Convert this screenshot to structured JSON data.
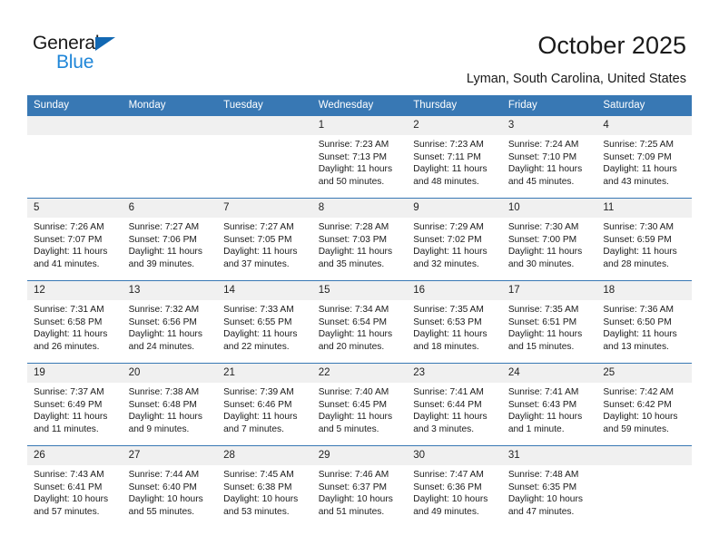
{
  "brand": {
    "name_dark": "General",
    "name_light": "Blue",
    "triangle_color": "#1268b3",
    "light_color": "#1f86d8"
  },
  "header": {
    "title": "October 2025",
    "location": "Lyman, South Carolina, United States"
  },
  "theme": {
    "header_blue": "#3878b4",
    "daynum_gray": "#f0f0f0",
    "text": "#1a1a1a"
  },
  "weekdays": [
    "Sunday",
    "Monday",
    "Tuesday",
    "Wednesday",
    "Thursday",
    "Friday",
    "Saturday"
  ],
  "weeks": [
    [
      {
        "day": "",
        "info": ""
      },
      {
        "day": "",
        "info": ""
      },
      {
        "day": "",
        "info": ""
      },
      {
        "day": "1",
        "info": "Sunrise: 7:23 AM\nSunset: 7:13 PM\nDaylight: 11 hours\nand 50 minutes."
      },
      {
        "day": "2",
        "info": "Sunrise: 7:23 AM\nSunset: 7:11 PM\nDaylight: 11 hours\nand 48 minutes."
      },
      {
        "day": "3",
        "info": "Sunrise: 7:24 AM\nSunset: 7:10 PM\nDaylight: 11 hours\nand 45 minutes."
      },
      {
        "day": "4",
        "info": "Sunrise: 7:25 AM\nSunset: 7:09 PM\nDaylight: 11 hours\nand 43 minutes."
      }
    ],
    [
      {
        "day": "5",
        "info": "Sunrise: 7:26 AM\nSunset: 7:07 PM\nDaylight: 11 hours\nand 41 minutes."
      },
      {
        "day": "6",
        "info": "Sunrise: 7:27 AM\nSunset: 7:06 PM\nDaylight: 11 hours\nand 39 minutes."
      },
      {
        "day": "7",
        "info": "Sunrise: 7:27 AM\nSunset: 7:05 PM\nDaylight: 11 hours\nand 37 minutes."
      },
      {
        "day": "8",
        "info": "Sunrise: 7:28 AM\nSunset: 7:03 PM\nDaylight: 11 hours\nand 35 minutes."
      },
      {
        "day": "9",
        "info": "Sunrise: 7:29 AM\nSunset: 7:02 PM\nDaylight: 11 hours\nand 32 minutes."
      },
      {
        "day": "10",
        "info": "Sunrise: 7:30 AM\nSunset: 7:00 PM\nDaylight: 11 hours\nand 30 minutes."
      },
      {
        "day": "11",
        "info": "Sunrise: 7:30 AM\nSunset: 6:59 PM\nDaylight: 11 hours\nand 28 minutes."
      }
    ],
    [
      {
        "day": "12",
        "info": "Sunrise: 7:31 AM\nSunset: 6:58 PM\nDaylight: 11 hours\nand 26 minutes."
      },
      {
        "day": "13",
        "info": "Sunrise: 7:32 AM\nSunset: 6:56 PM\nDaylight: 11 hours\nand 24 minutes."
      },
      {
        "day": "14",
        "info": "Sunrise: 7:33 AM\nSunset: 6:55 PM\nDaylight: 11 hours\nand 22 minutes."
      },
      {
        "day": "15",
        "info": "Sunrise: 7:34 AM\nSunset: 6:54 PM\nDaylight: 11 hours\nand 20 minutes."
      },
      {
        "day": "16",
        "info": "Sunrise: 7:35 AM\nSunset: 6:53 PM\nDaylight: 11 hours\nand 18 minutes."
      },
      {
        "day": "17",
        "info": "Sunrise: 7:35 AM\nSunset: 6:51 PM\nDaylight: 11 hours\nand 15 minutes."
      },
      {
        "day": "18",
        "info": "Sunrise: 7:36 AM\nSunset: 6:50 PM\nDaylight: 11 hours\nand 13 minutes."
      }
    ],
    [
      {
        "day": "19",
        "info": "Sunrise: 7:37 AM\nSunset: 6:49 PM\nDaylight: 11 hours\nand 11 minutes."
      },
      {
        "day": "20",
        "info": "Sunrise: 7:38 AM\nSunset: 6:48 PM\nDaylight: 11 hours\nand 9 minutes."
      },
      {
        "day": "21",
        "info": "Sunrise: 7:39 AM\nSunset: 6:46 PM\nDaylight: 11 hours\nand 7 minutes."
      },
      {
        "day": "22",
        "info": "Sunrise: 7:40 AM\nSunset: 6:45 PM\nDaylight: 11 hours\nand 5 minutes."
      },
      {
        "day": "23",
        "info": "Sunrise: 7:41 AM\nSunset: 6:44 PM\nDaylight: 11 hours\nand 3 minutes."
      },
      {
        "day": "24",
        "info": "Sunrise: 7:41 AM\nSunset: 6:43 PM\nDaylight: 11 hours\nand 1 minute."
      },
      {
        "day": "25",
        "info": "Sunrise: 7:42 AM\nSunset: 6:42 PM\nDaylight: 10 hours\nand 59 minutes."
      }
    ],
    [
      {
        "day": "26",
        "info": "Sunrise: 7:43 AM\nSunset: 6:41 PM\nDaylight: 10 hours\nand 57 minutes."
      },
      {
        "day": "27",
        "info": "Sunrise: 7:44 AM\nSunset: 6:40 PM\nDaylight: 10 hours\nand 55 minutes."
      },
      {
        "day": "28",
        "info": "Sunrise: 7:45 AM\nSunset: 6:38 PM\nDaylight: 10 hours\nand 53 minutes."
      },
      {
        "day": "29",
        "info": "Sunrise: 7:46 AM\nSunset: 6:37 PM\nDaylight: 10 hours\nand 51 minutes."
      },
      {
        "day": "30",
        "info": "Sunrise: 7:47 AM\nSunset: 6:36 PM\nDaylight: 10 hours\nand 49 minutes."
      },
      {
        "day": "31",
        "info": "Sunrise: 7:48 AM\nSunset: 6:35 PM\nDaylight: 10 hours\nand 47 minutes."
      },
      {
        "day": "",
        "info": ""
      }
    ]
  ]
}
